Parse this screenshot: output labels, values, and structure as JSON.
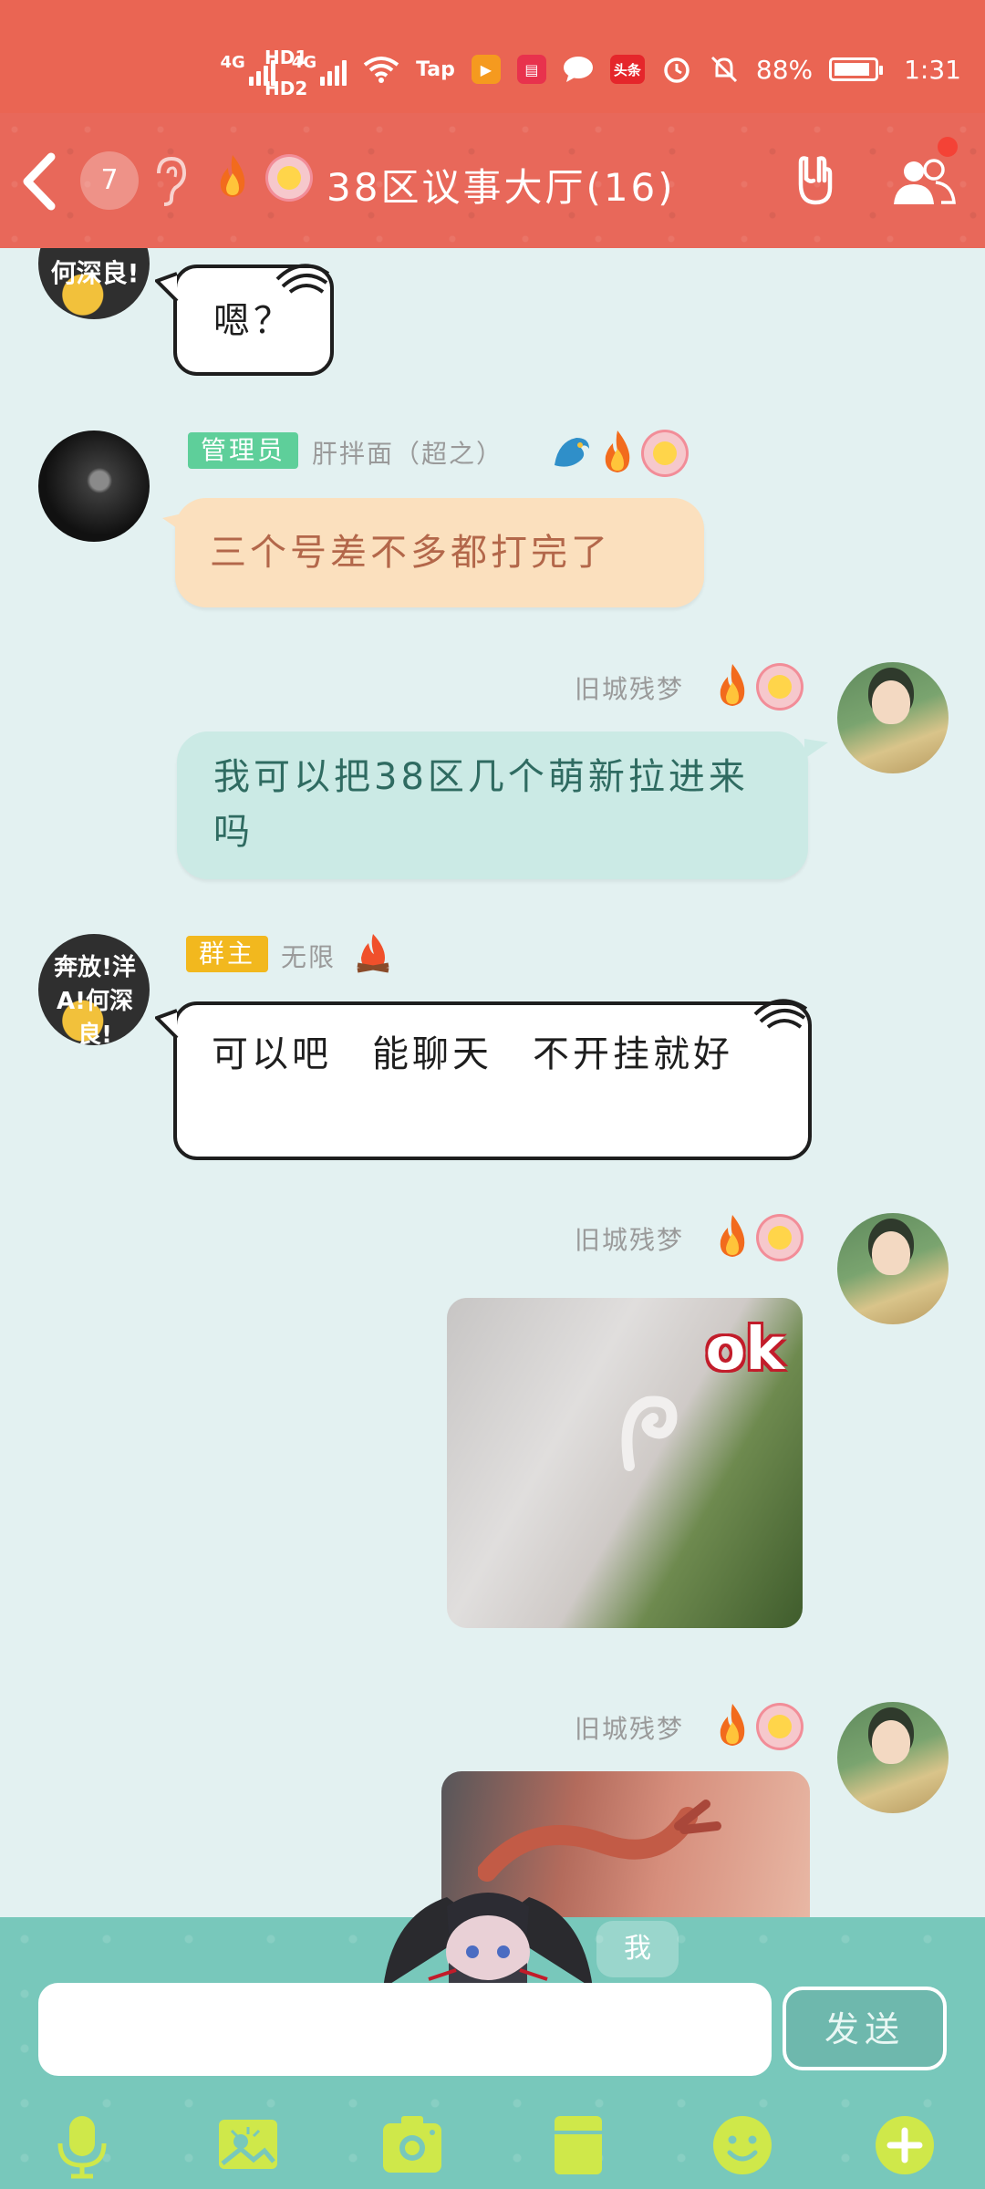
{
  "status_bar": {
    "network_labels": [
      "HD1",
      "HD2"
    ],
    "signal1": "4G",
    "signal2": "4G",
    "app_tap": "Tap",
    "app_toutiao": "头条",
    "battery": "88%",
    "time": "1:31"
  },
  "header": {
    "unread_count": "7",
    "title": "38区议事大厅(16)"
  },
  "messages": [
    {
      "bubble": "嗯？"
    },
    {
      "role_tag": "管理员",
      "sender": "肝拌面（超之）",
      "text": "三个号差不多都打完了"
    },
    {
      "sender": "旧城残梦",
      "text": "我可以把38区几个萌新拉进来吗"
    },
    {
      "role_tag": "群主",
      "sender": "无限",
      "avatar_text": "奔放!洋A!何深良!",
      "text": "可以吧　能聊天　不开挂就好"
    },
    {
      "sender": "旧城残梦",
      "image_caption": "ok"
    },
    {
      "sender": "旧城残梦"
    }
  ],
  "input_bar": {
    "me_label": "我",
    "input_value": "",
    "send_label": "发送"
  },
  "colors": {
    "status_bar": "#ea6553",
    "title_bar": "#e8685a",
    "chat_bg": "#e3f1f1",
    "input_bar": "#78c8bb",
    "admin_tag": "#5ecf9a",
    "owner_tag": "#f2b81e"
  },
  "toolbar_icons": [
    "microphone-icon",
    "photo-icon",
    "camera-icon",
    "file-icon",
    "emoji-icon",
    "plus-icon"
  ]
}
